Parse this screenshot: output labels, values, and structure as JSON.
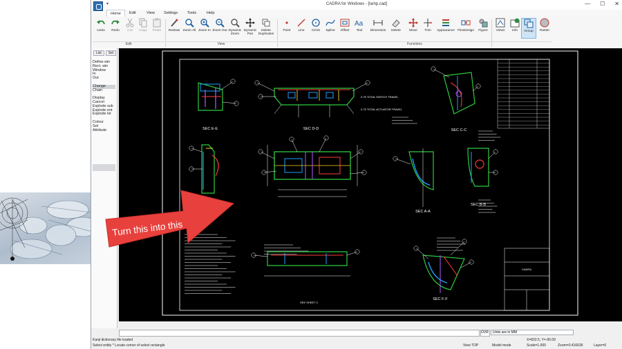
{
  "window": {
    "title": "CADRA for Windows - [lamp.cad]",
    "controls": [
      "—",
      "☐",
      "✕"
    ]
  },
  "quick_access": "▾",
  "menu": {
    "tabs": [
      "Home",
      "Edit",
      "View",
      "Settings",
      "Tools",
      "Help"
    ],
    "active": "Home"
  },
  "ribbon": {
    "groups": {
      "edit": "Edit",
      "view": "View",
      "functions": "Functions"
    },
    "edit_buttons": [
      "Undo",
      "Redo",
      "Cut",
      "Copy",
      "Paste"
    ],
    "view_buttons": [
      "Redraw",
      "Zoom All",
      "Zoom In",
      "Zoom Out",
      "Dynamic Zoom",
      "Dynamic Pan",
      "Delete Duplicates"
    ],
    "function_buttons": [
      "Point",
      "Line",
      "Circle",
      "Spline",
      "Offset",
      "Text",
      "Dimension",
      "Delete",
      "Move",
      "Trim",
      "Appearance",
      "FlexDesign",
      "Figure",
      "Views",
      "Info",
      "Group",
      "Raster"
    ],
    "selected_button": "Group"
  },
  "left_panel": {
    "tabs": [
      "List",
      "Sel"
    ],
    "items": [
      "Define win",
      "Rect. win",
      "Window",
      "In",
      "Out",
      "",
      "Change",
      "Chain",
      "",
      "Display",
      "Cancel",
      "Explode sub",
      "Explode ent",
      "Explode txt",
      "",
      "Colour",
      "Set",
      "Attribute"
    ],
    "highlighted": "Change"
  },
  "drawing": {
    "sections": [
      "SEC E-E",
      "SEC D-D",
      "SEC C-C",
      "SEC B-B",
      "SEC A-A",
      "SEC F-F"
    ],
    "notes": [
      "0.75 TOTAL SWITCH TRAVEL",
      "0.75 TOTAL ACTUATOR TRAVEL",
      "SEE SHEET 2"
    ],
    "title_block": "CADRA"
  },
  "overlay": {
    "callout_text": "Turn this into this"
  },
  "command_line": {
    "value": "",
    "ovr": "OVR",
    "units": "Units are in MM"
  },
  "status_bar": {
    "message": "Kanji dictionary file loaded",
    "prompt": "Select entity * Locate corner of select rectangle",
    "coords": "X=832.5, Y=-90.09",
    "view": "View TOP",
    "mode": "Model mode",
    "scale": "Scale=1.000",
    "zoom": "Zoom=0.416636",
    "layer": "Layer=0"
  },
  "colors": {
    "accent": "#0f5a9c",
    "callout": "#e8413d",
    "canvas": "#000000"
  }
}
